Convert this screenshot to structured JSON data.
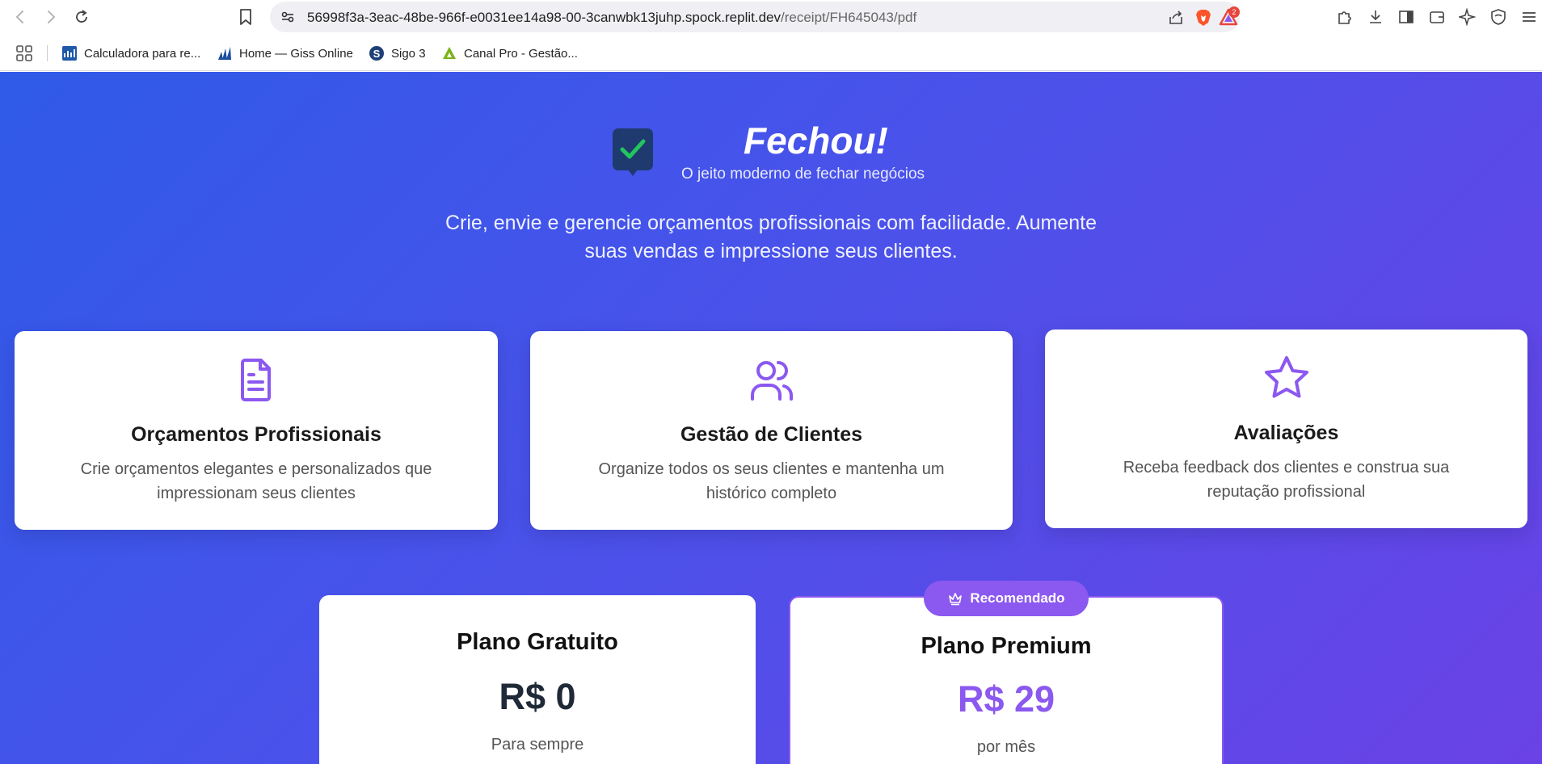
{
  "browser": {
    "url_host": "56998f3a-3eac-48be-966f-e0031ee14a98-00-3canwbk13juhp.spock.replit.dev",
    "url_path": "/receipt/FH645043/pdf",
    "rewards_count": "2",
    "bookmarks": [
      {
        "label": "Calculadora para re...",
        "icon": "chart-favicon"
      },
      {
        "label": "Home — Giss Online",
        "icon": "giss-favicon"
      },
      {
        "label": "Sigo 3",
        "icon": "sigo-favicon"
      },
      {
        "label": "Canal Pro - Gestão...",
        "icon": "canalpro-favicon"
      }
    ]
  },
  "brand": {
    "title": "Fechou!",
    "tagline": "O jeito moderno de fechar negócios"
  },
  "hero": {
    "line1": "Crie, envie e gerencie orçamentos profissionais com facilidade. Aumente",
    "line2": "suas vendas e impressione seus clientes."
  },
  "features": [
    {
      "title": "Orçamentos Profissionais",
      "desc": "Crie orçamentos elegantes e personalizados que impressionam seus clientes",
      "icon": "document-icon"
    },
    {
      "title": "Gestão de Clientes",
      "desc": "Organize todos os seus clientes e mantenha um histórico completo",
      "icon": "users-icon"
    },
    {
      "title": "Avaliações",
      "desc": "Receba feedback dos clientes e construa sua reputação profissional",
      "icon": "star-icon"
    }
  ],
  "plans": {
    "free": {
      "name": "Plano Gratuito",
      "price": "R$ 0",
      "period": "Para sempre"
    },
    "premium": {
      "name": "Plano Premium",
      "price": "R$ 29",
      "period": "por mês",
      "badge": "Recomendado"
    }
  },
  "colors": {
    "accent": "#8b58f0",
    "price_dark": "#1f2937",
    "logo_bg": "#1f3a6e",
    "logo_check": "#22c55e"
  }
}
